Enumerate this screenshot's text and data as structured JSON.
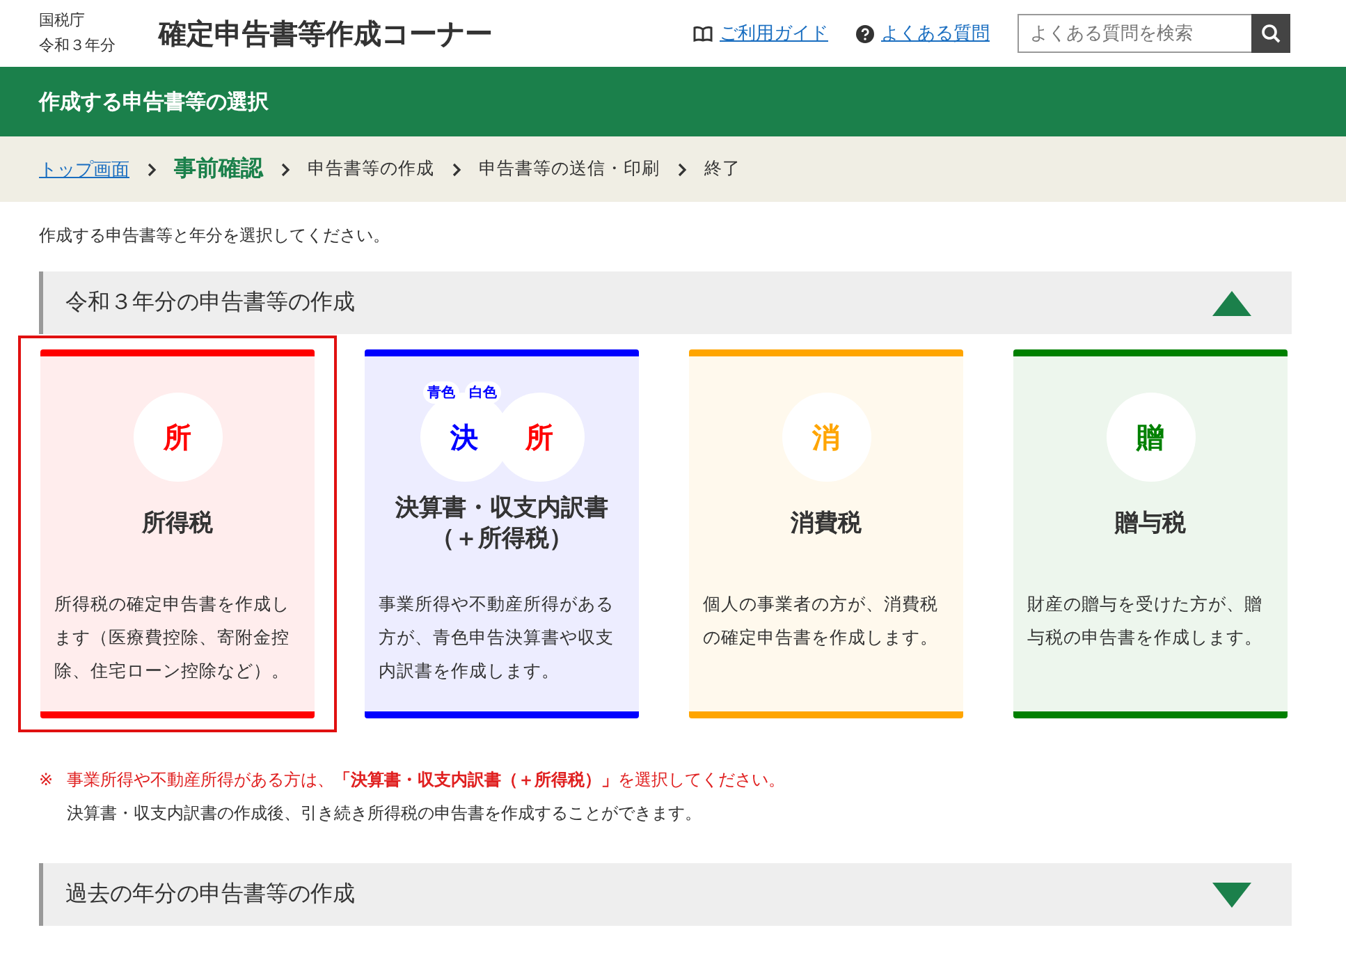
{
  "header": {
    "agency": "国税庁",
    "year": "令和３年分",
    "title": "確定申告書等作成コーナー",
    "links": [
      {
        "kind": "book",
        "label": "ご利用ガイド"
      },
      {
        "kind": "help",
        "label": "よくある質問"
      }
    ],
    "search": {
      "placeholder": "よくある質問を検索"
    }
  },
  "banner": {
    "title": "作成する申告書等の選択"
  },
  "breadcrumb": [
    {
      "kind": "link",
      "label": "トップ画面"
    },
    {
      "kind": "current",
      "label": "事前確認"
    },
    {
      "kind": "step",
      "label": "申告書等の作成"
    },
    {
      "kind": "step",
      "label": "申告書等の送信・印刷"
    },
    {
      "kind": "step",
      "label": "終了"
    }
  ],
  "intro": "作成する申告書等と年分を選択してください。",
  "sections": [
    {
      "title": "令和３年分の申告書等の作成",
      "expanded": true,
      "cards": [
        {
          "selected": true,
          "color": "#ff0000",
          "glyphs": [
            {
              "char": "所",
              "color": "#ff0000"
            }
          ],
          "title_lines": [
            "所得税"
          ],
          "description": "所得税の確定申告書を作成します（医療費控除、寄附金控除、住宅ローン控除など）。"
        },
        {
          "selected": false,
          "color": "#0000ff",
          "tags": [
            "青色",
            "白色"
          ],
          "glyphs": [
            {
              "char": "決",
              "color": "#0000ff"
            },
            {
              "char": "所",
              "color": "#ff0000"
            }
          ],
          "title_lines": [
            "決算書・収支内訳書",
            "（＋所得税）"
          ],
          "description": "事業所得や不動産所得がある方が、青色申告決算書や収支内訳書を作成します。"
        },
        {
          "selected": false,
          "color": "#ffa500",
          "glyphs": [
            {
              "char": "消",
              "color": "#ffa500"
            }
          ],
          "title_lines": [
            "消費税"
          ],
          "description": "個人の事業者の方が、消費税の確定申告書を作成します。"
        },
        {
          "selected": false,
          "color": "#008000",
          "glyphs": [
            {
              "char": "贈",
              "color": "#008000"
            }
          ],
          "title_lines": [
            "贈与税"
          ],
          "description": "財産の贈与を受けた方が、贈与税の申告書を作成します。"
        }
      ],
      "note": {
        "mark": "※",
        "text": "事業所得や不動産所得がある方は、**「決算書・収支内訳書（＋所得税）」**を選択してください。",
        "sub": "決算書・収支内訳書の作成後、引き続き所得税の申告書を作成することができます。"
      }
    },
    {
      "title": "過去の年分の申告書等の作成",
      "expanded": false
    }
  ]
}
